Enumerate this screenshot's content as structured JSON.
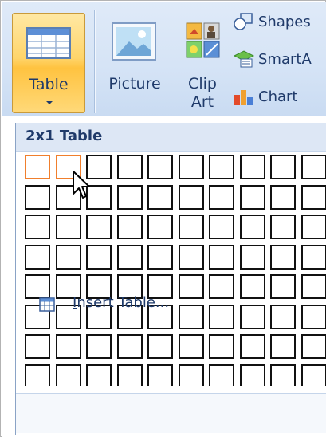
{
  "ribbon": {
    "table_label": "Table",
    "picture_label": "Picture",
    "clipart_label_line1": "Clip",
    "clipart_label_line2": "Art",
    "shapes_label": "Shapes",
    "smartart_label": "SmartA",
    "chart_label": "Chart"
  },
  "dropdown": {
    "header": "2x1 Table",
    "grid": {
      "columns": 10,
      "rows": 8,
      "selected_columns": 2,
      "selected_rows": 1
    },
    "insert_table_mnemonic": "I",
    "insert_table_rest": "nsert Table..."
  },
  "colors": {
    "accent_orange": "#f07f2d",
    "text_blue": "#1f3a6a",
    "ribbon_bg": "#d6e4f6"
  },
  "icons": [
    "table-icon",
    "picture-icon",
    "clip-art-icon",
    "shapes-icon",
    "smartart-icon",
    "chart-icon",
    "insert-table-icon",
    "mouse-cursor-icon",
    "dropdown-arrow-icon"
  ]
}
